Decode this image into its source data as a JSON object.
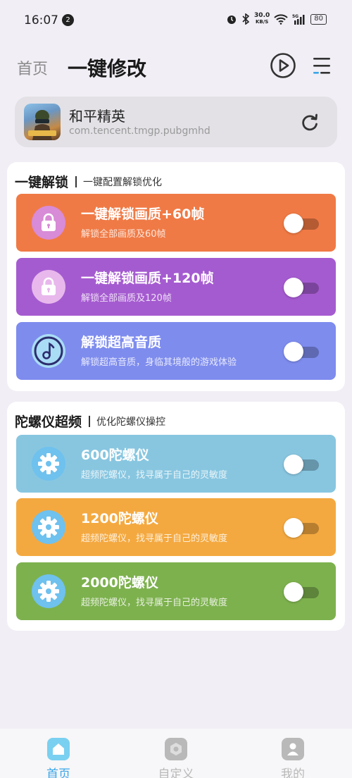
{
  "status_bar": {
    "time": "16:07",
    "notification_count": "2",
    "speed_value": "30.0",
    "speed_unit": "KB/S",
    "battery": "80"
  },
  "header": {
    "home_link": "首页",
    "title": "一键修改"
  },
  "game": {
    "name": "和平精英",
    "package": "com.tencent.tmgp.pubgmhd"
  },
  "sections": [
    {
      "title": "一键解锁",
      "subtitle": "一键配置解锁优化",
      "options": [
        {
          "title": "一键解锁画质+60帧",
          "desc": "解锁全部画质及60帧",
          "icon": "lock-icon",
          "color": "#f07a45",
          "icon_bg": "#d88bd6",
          "enabled": false
        },
        {
          "title": "一键解锁画质+120帧",
          "desc": "解锁全部画质及120帧",
          "icon": "lock-icon",
          "color": "#a55bd0",
          "icon_bg": "#e8b8ec",
          "enabled": false
        },
        {
          "title": "解锁超高音质",
          "desc": "解锁超高音质，身临其境般的游戏体验",
          "icon": "music-note-icon",
          "color": "#7e8cee",
          "icon_bg": "#a9dcf5",
          "enabled": false
        }
      ]
    },
    {
      "title": "陀螺仪超频",
      "subtitle": "优化陀螺仪操控",
      "options": [
        {
          "title": "600陀螺仪",
          "desc": "超频陀螺仪，找寻属于自己的灵敏度",
          "icon": "gear-icon",
          "color": "#88c6e0",
          "icon_bg": "#6fc1ee",
          "enabled": false
        },
        {
          "title": "1200陀螺仪",
          "desc": "超频陀螺仪，找寻属于自己的灵敏度",
          "icon": "gear-icon",
          "color": "#f4a940",
          "icon_bg": "#6fc1ee",
          "enabled": false
        },
        {
          "title": "2000陀螺仪",
          "desc": "超频陀螺仪，找寻属于自己的灵敏度",
          "icon": "gear-icon",
          "color": "#7db14e",
          "icon_bg": "#6fc1ee",
          "enabled": false
        }
      ]
    }
  ],
  "bottom_nav": [
    {
      "label": "首页",
      "icon": "home-icon",
      "active": true
    },
    {
      "label": "自定义",
      "icon": "hexagon-icon",
      "active": false
    },
    {
      "label": "我的",
      "icon": "user-icon",
      "active": false
    }
  ],
  "colors": {
    "accent": "#3aa6e8",
    "inactive": "#b9b9b9"
  }
}
